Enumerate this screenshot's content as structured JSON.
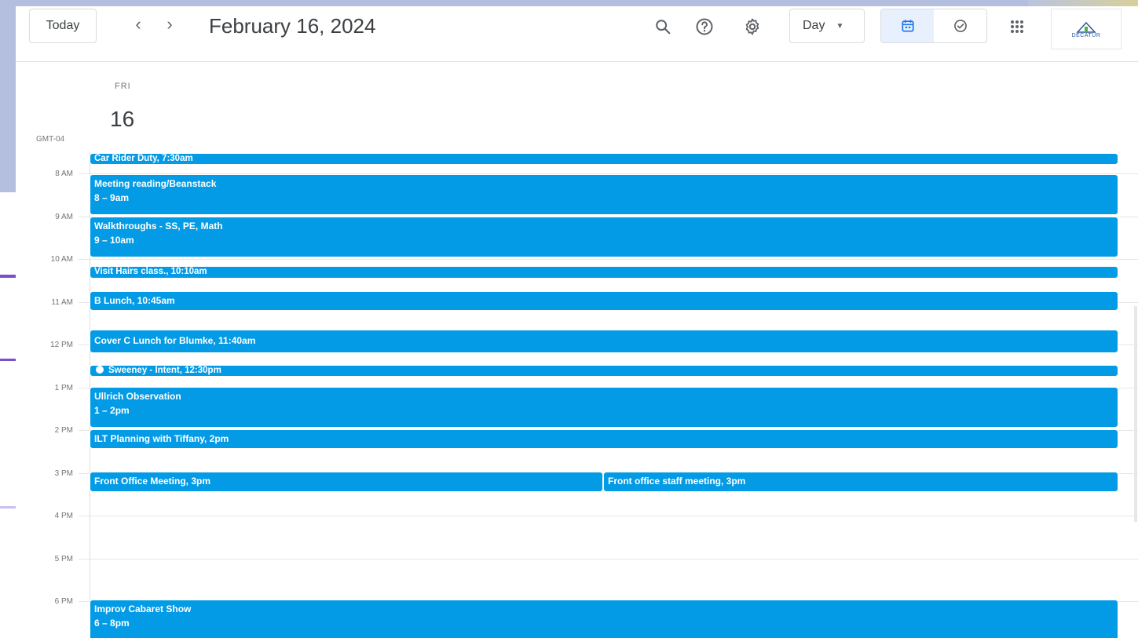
{
  "header": {
    "today_label": "Today",
    "prev_icon": "‹",
    "next_icon": "›",
    "date_title": "February 16, 2024",
    "view_label": "Day",
    "logo_text": "DECATUR"
  },
  "day": {
    "dow": "FRI",
    "dom": "16",
    "timezone": "GMT-04"
  },
  "hours": [
    "8 AM",
    "9 AM",
    "10 AM",
    "11 AM",
    "12 PM",
    "1 PM",
    "2 PM",
    "3 PM",
    "4 PM",
    "5 PM",
    "6 PM"
  ],
  "events": {
    "e1": {
      "title": "Car Rider Duty, 7:30am"
    },
    "e2": {
      "title": "Meeting reading/Beanstack",
      "time": "8 – 9am"
    },
    "e3": {
      "title": "Walkthroughs - SS, PE, Math",
      "time": "9 – 10am"
    },
    "e4": {
      "title": "Visit Hairs class., 10:10am"
    },
    "e5": {
      "title": "B Lunch, 10:45am"
    },
    "e6": {
      "title": "Cover C Lunch for Blumke, 11:40am"
    },
    "e7": {
      "title": "Sweeney - Intent, 12:30pm"
    },
    "e8": {
      "title": "Ullrich Observation",
      "time": "1 – 2pm"
    },
    "e9": {
      "title": "ILT Planning with Tiffany, 2pm"
    },
    "e10": {
      "title": "Front Office Meeting, 3pm"
    },
    "e11": {
      "title": "Front office staff meeting, 3pm"
    },
    "e12": {
      "title": "Improv Cabaret Show",
      "time": "6 – 8pm"
    }
  },
  "colors": {
    "event": "#039be5",
    "accent": "#1a73e8"
  }
}
